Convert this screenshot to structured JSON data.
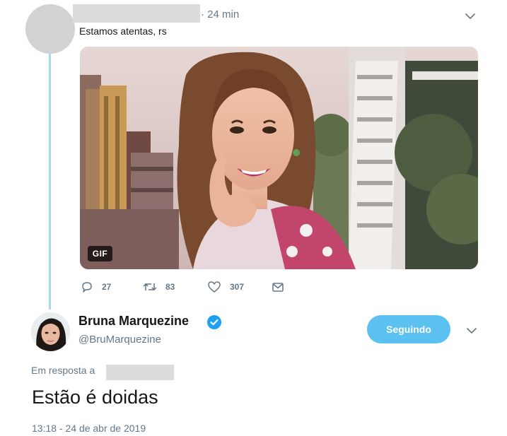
{
  "reply_tweet": {
    "time": "· 24 min",
    "text": "Estamos atentas, rs",
    "media_badge": "GIF",
    "stats": {
      "replies": "27",
      "retweets": "83",
      "likes": "307"
    }
  },
  "main_tweet": {
    "display_name": "Bruna Marquezine",
    "handle": "@BruMarquezine",
    "follow_button": "Seguindo",
    "reply_prefix": "Em resposta a",
    "text": "Estão é doidas",
    "timestamp": "13:18 - 24 de abr de 2019"
  },
  "colors": {
    "accent": "#1da1f2",
    "follow_button_bg": "#5bc1f0",
    "thread_line": "#a9d8f2",
    "secondary_text": "#657786"
  }
}
